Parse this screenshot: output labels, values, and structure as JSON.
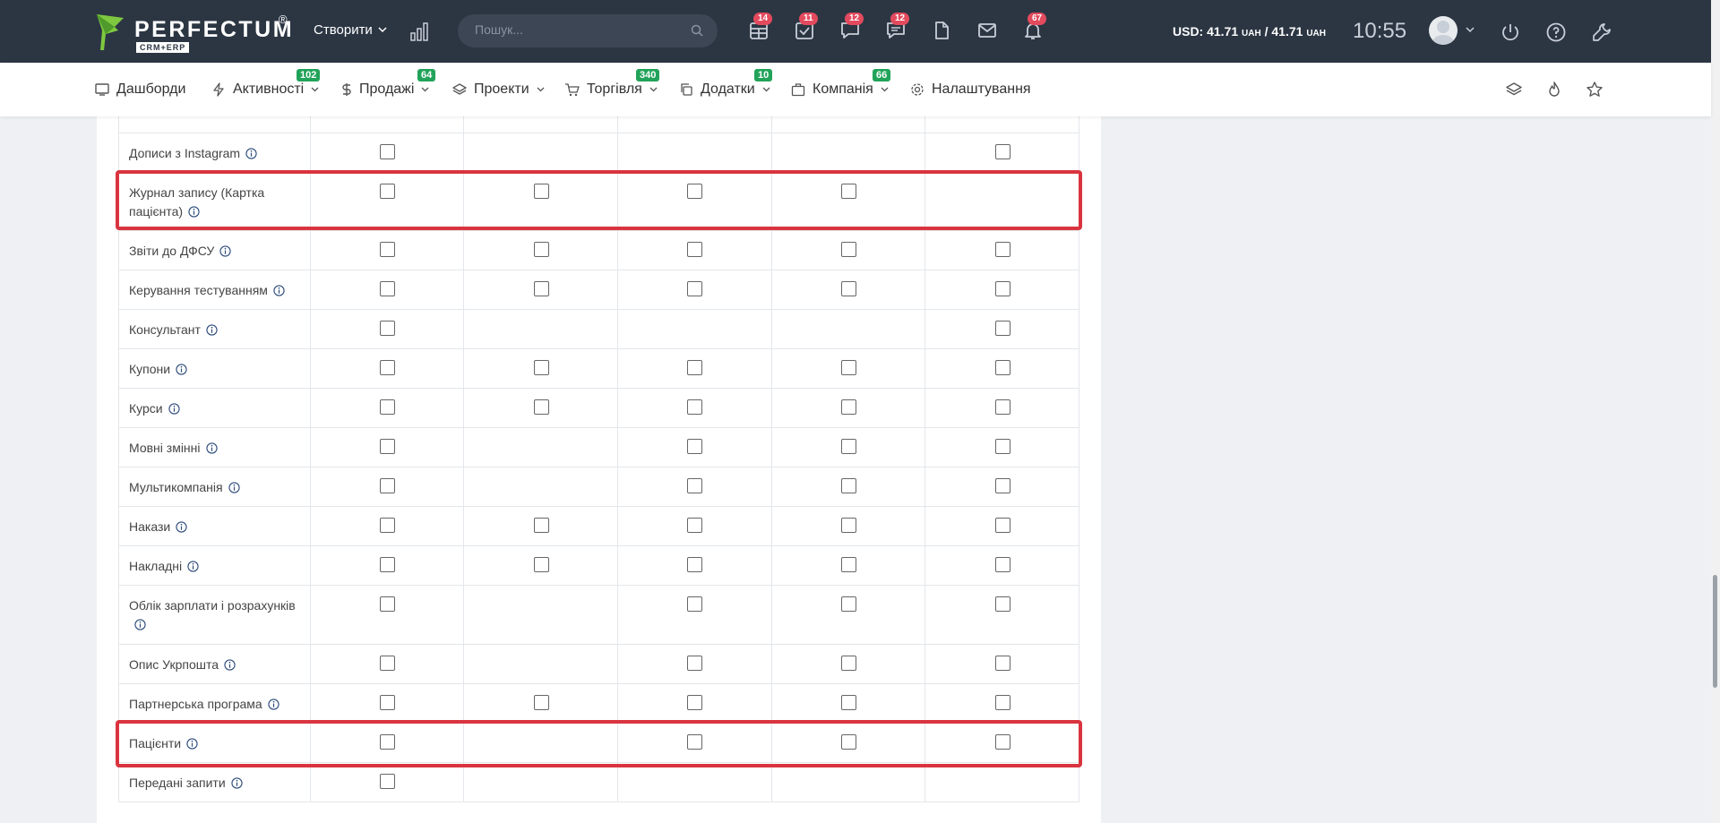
{
  "header": {
    "brand_name": "PERFECTUM",
    "brand_reg": "®",
    "brand_sub": "CRM+ERP",
    "create_label": "Створити",
    "search_placeholder": "Пошук...",
    "icons": [
      {
        "name": "calendar-grid-icon",
        "badge": "14"
      },
      {
        "name": "task-check-icon",
        "badge": "11"
      },
      {
        "name": "chat-bubble-icon",
        "badge": "12"
      },
      {
        "name": "comments-icon",
        "badge": "12"
      },
      {
        "name": "document-icon",
        "badge": ""
      },
      {
        "name": "mail-icon",
        "badge": ""
      },
      {
        "name": "bell-icon",
        "badge": "67"
      }
    ],
    "currency_main": "USD: 41.71 ",
    "currency_unit1": "UAH",
    "currency_sep": " / 41.71 ",
    "currency_unit2": "UAH",
    "time": "10:55"
  },
  "nav": {
    "items": [
      {
        "label": "Дашборди",
        "badge": "",
        "chevron": false
      },
      {
        "label": "Активності",
        "badge": "102",
        "chevron": true
      },
      {
        "label": "Продажі",
        "badge": "64",
        "chevron": true
      },
      {
        "label": "Проекти",
        "badge": "",
        "chevron": true
      },
      {
        "label": "Торгівля",
        "badge": "340",
        "chevron": true
      },
      {
        "label": "Додатки",
        "badge": "10",
        "chevron": true
      },
      {
        "label": "Компанія",
        "badge": "66",
        "chevron": true
      },
      {
        "label": "Налаштування",
        "badge": "",
        "chevron": false
      }
    ]
  },
  "rows": [
    {
      "label": "Дописи з Instagram",
      "checks": [
        true,
        false,
        false,
        false,
        true
      ]
    },
    {
      "label": "Журнал запису (Картка пацієнта)",
      "checks": [
        true,
        true,
        true,
        true,
        false
      ],
      "highlight": true
    },
    {
      "label": "Звіти до ДФСУ",
      "checks": [
        true,
        true,
        true,
        true,
        true
      ]
    },
    {
      "label": "Керування тестуванням",
      "checks": [
        true,
        true,
        true,
        true,
        true
      ]
    },
    {
      "label": "Консультант",
      "checks": [
        true,
        false,
        false,
        false,
        true
      ]
    },
    {
      "label": "Купони",
      "checks": [
        true,
        true,
        true,
        true,
        true
      ]
    },
    {
      "label": "Курси",
      "checks": [
        true,
        true,
        true,
        true,
        true
      ]
    },
    {
      "label": "Мовні змінні",
      "checks": [
        true,
        false,
        true,
        true,
        true
      ]
    },
    {
      "label": "Мультикомпанія",
      "checks": [
        true,
        false,
        true,
        true,
        true
      ]
    },
    {
      "label": "Накази",
      "checks": [
        true,
        true,
        true,
        true,
        true
      ]
    },
    {
      "label": "Накладні",
      "checks": [
        true,
        true,
        true,
        true,
        true
      ]
    },
    {
      "label": "Облік зарплати і розрахунків",
      "checks": [
        true,
        false,
        true,
        true,
        true
      ]
    },
    {
      "label": "Опис Укрпошта",
      "checks": [
        true,
        false,
        true,
        true,
        true
      ]
    },
    {
      "label": "Партнерська програма",
      "checks": [
        true,
        true,
        true,
        true,
        true
      ]
    },
    {
      "label": "Пацієнти",
      "checks": [
        true,
        false,
        true,
        true,
        true
      ],
      "highlight": true
    },
    {
      "label": "Передані запити",
      "checks": [
        true,
        false,
        false,
        false,
        false
      ]
    }
  ]
}
